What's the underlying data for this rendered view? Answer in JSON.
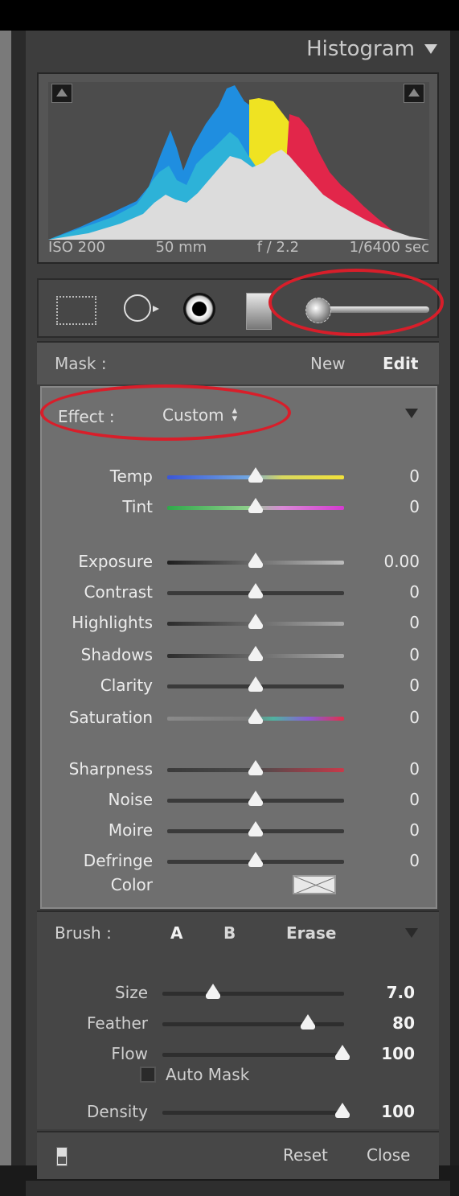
{
  "histogram": {
    "title": "Histogram",
    "iso": "ISO 200",
    "focal": "50 mm",
    "aperture": "f / 2.2",
    "shutter": "1/6400 sec"
  },
  "tools": {
    "icons": [
      "crop-overlay-icon",
      "spot-removal-icon",
      "red-eye-icon",
      "graduated-filter-icon",
      "adjustment-brush-icon"
    ],
    "selected": "adjustment-brush-icon",
    "annotation_color": "#d81e2a"
  },
  "mask": {
    "label": "Mask :",
    "new": "New",
    "edit": "Edit"
  },
  "effect": {
    "label": "Effect :",
    "preset": "Custom",
    "sliders_group1": [
      {
        "name": "Temp",
        "value": "0",
        "pos": 0.5,
        "track": "linear-gradient(90deg,#3a56d8,#6fa4e0 45%,#d8d860 65%,#f2e23a)"
      },
      {
        "name": "Tint",
        "value": "0",
        "pos": 0.5,
        "track": "linear-gradient(90deg,#2fa84a,#8ccf8a 45%,#d98ad6 65%,#d43ad0)"
      }
    ],
    "sliders_group2": [
      {
        "name": "Exposure",
        "value": "0.00",
        "pos": 0.5,
        "track": "linear-gradient(90deg,#1e1e1e,#bdbdbd)"
      },
      {
        "name": "Contrast",
        "value": "0",
        "pos": 0.5,
        "track": "#3a3a3a"
      },
      {
        "name": "Highlights",
        "value": "0",
        "pos": 0.5,
        "track": "linear-gradient(90deg,#2c2c2c,#a8a8a8)"
      },
      {
        "name": "Shadows",
        "value": "0",
        "pos": 0.5,
        "track": "linear-gradient(90deg,#2c2c2c,#a8a8a8)"
      },
      {
        "name": "Clarity",
        "value": "0",
        "pos": 0.5,
        "track": "#3a3a3a"
      },
      {
        "name": "Saturation",
        "value": "0",
        "pos": 0.5,
        "track": "linear-gradient(90deg,#8a8a8a,#7a7a7a 45%,#4fb3a0 60%,#8a5ad8 80%,#e0304a)"
      }
    ],
    "sliders_group3": [
      {
        "name": "Sharpness",
        "value": "0",
        "pos": 0.5,
        "track": "linear-gradient(90deg,#3a3a3a,#4a4a4a 50%,#c83a4a)"
      },
      {
        "name": "Noise",
        "value": "0",
        "pos": 0.5,
        "track": "#3a3a3a"
      },
      {
        "name": "Moire",
        "value": "0",
        "pos": 0.5,
        "track": "#3a3a3a"
      },
      {
        "name": "Defringe",
        "value": "0",
        "pos": 0.5,
        "track": "#3a3a3a"
      }
    ],
    "color_label": "Color"
  },
  "brush": {
    "label": "Brush :",
    "a": "A",
    "b": "B",
    "erase": "Erase",
    "sliders": [
      {
        "name": "Size",
        "value": "7.0",
        "pos": 0.28
      },
      {
        "name": "Feather",
        "value": "80",
        "pos": 0.8
      },
      {
        "name": "Flow",
        "value": "100",
        "pos": 0.99
      }
    ],
    "auto_mask": "Auto Mask",
    "density": {
      "name": "Density",
      "value": "100",
      "pos": 0.99
    }
  },
  "footer": {
    "reset": "Reset",
    "close": "Close"
  }
}
